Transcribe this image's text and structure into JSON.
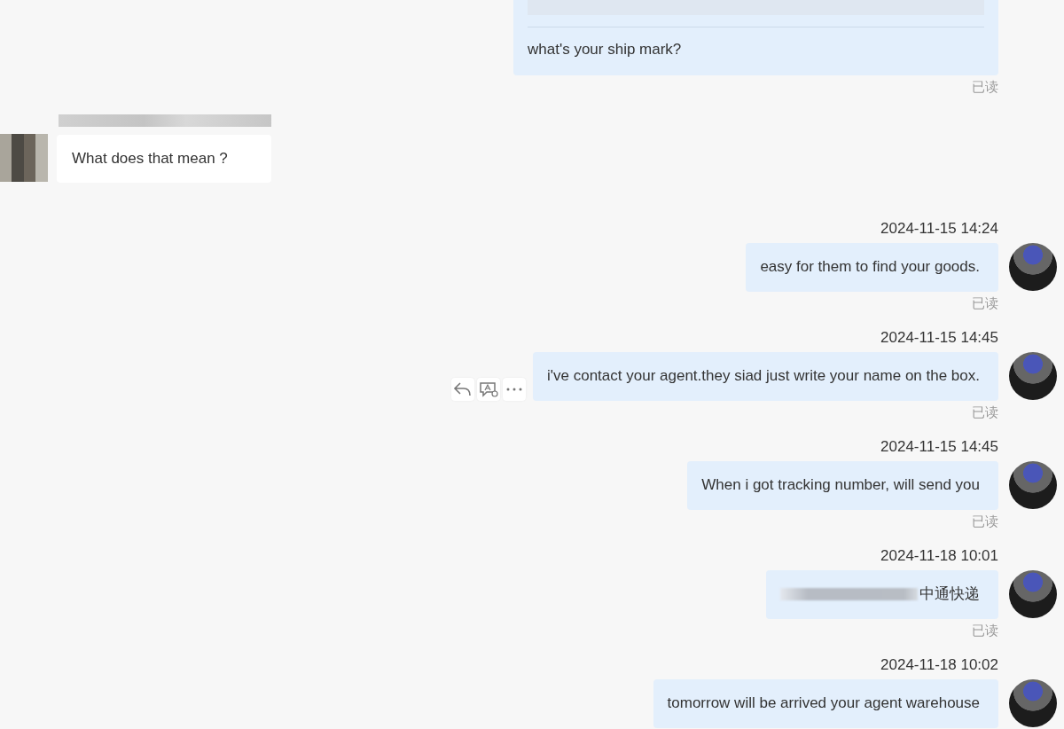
{
  "messages": [
    {
      "kind": "outgoing",
      "show_avatar": false,
      "quote": true,
      "text": "what's your ship mark?",
      "status": "已读"
    },
    {
      "kind": "incoming",
      "sender_hidden": true,
      "text": "What does that mean ?"
    },
    {
      "kind": "outgoing",
      "show_avatar": true,
      "time": "2024-11-15 14:24",
      "text": "easy for them to find your goods.",
      "status": "已读"
    },
    {
      "kind": "outgoing",
      "show_avatar": true,
      "time": "2024-11-15 14:45",
      "text": "i've contact your agent.they siad just write your name on the box.",
      "status": "已读",
      "hover_actions": true
    },
    {
      "kind": "outgoing",
      "show_avatar": true,
      "time": "2024-11-15 14:45",
      "text": "When i got tracking number, will send you",
      "status": "已读"
    },
    {
      "kind": "outgoing",
      "show_avatar": true,
      "time": "2024-11-18 10:01",
      "redacted_prefix": true,
      "text": "中通快递",
      "status": "已读"
    },
    {
      "kind": "outgoing",
      "show_avatar": true,
      "time": "2024-11-18 10:02",
      "text": "tomorrow will be arrived your agent warehouse"
    }
  ]
}
